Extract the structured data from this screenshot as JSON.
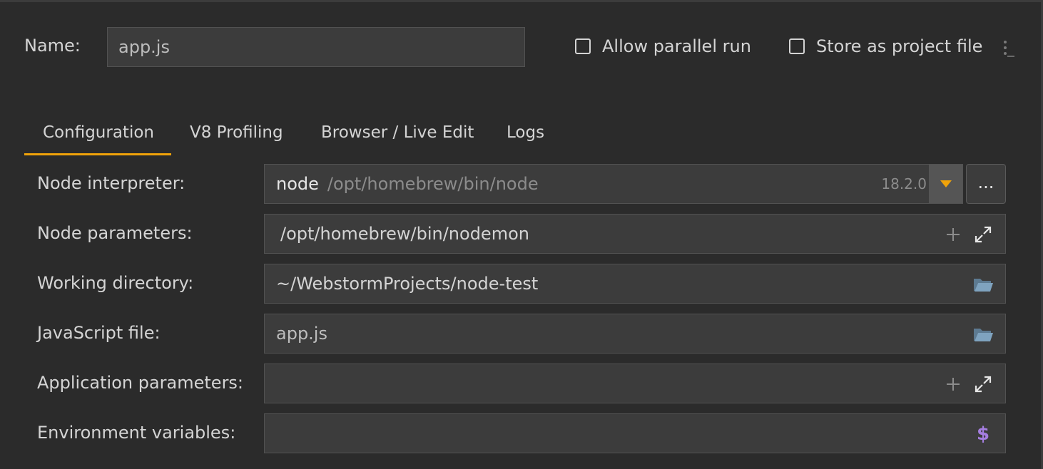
{
  "header": {
    "name_label": "Name:",
    "name_value": "app.js",
    "allow_parallel_run_label": "Allow parallel run",
    "allow_parallel_run_checked": false,
    "store_as_project_file_label": "Store as project file",
    "store_as_project_file_checked": false
  },
  "tabs": [
    {
      "label": "Configuration",
      "active": true
    },
    {
      "label": "V8 Profiling",
      "active": false
    },
    {
      "label": "Browser / Live Edit",
      "active": false
    },
    {
      "label": "Logs",
      "active": false
    }
  ],
  "form": {
    "node_interpreter": {
      "label": "Node interpreter:",
      "name": "node",
      "path": "/opt/homebrew/bin/node",
      "version": "18.2.0",
      "browse_label": "..."
    },
    "node_parameters": {
      "label": "Node parameters:",
      "value": "/opt/homebrew/bin/nodemon"
    },
    "working_directory": {
      "label": "Working directory:",
      "value": "~/WebstormProjects/node-test"
    },
    "javascript_file": {
      "label": "JavaScript file:",
      "value": "app.js"
    },
    "application_parameters": {
      "label": "Application parameters:",
      "value": ""
    },
    "environment_variables": {
      "label": "Environment variables:",
      "value": "",
      "icon_glyph": "$"
    }
  },
  "colors": {
    "background": "#2b2b2b",
    "field_background": "#3c3c3c",
    "accent_orange": "#f0a30a",
    "folder_icon": "#6f8fa8",
    "dollar_icon": "#a57ee0"
  },
  "icons": {
    "kebab": "more-vertical-icon",
    "dropdown": "dropdown-arrow-icon",
    "plus": "plus-icon",
    "expand": "expand-icon",
    "folder": "folder-open-icon",
    "dollar": "dollar-icon"
  }
}
